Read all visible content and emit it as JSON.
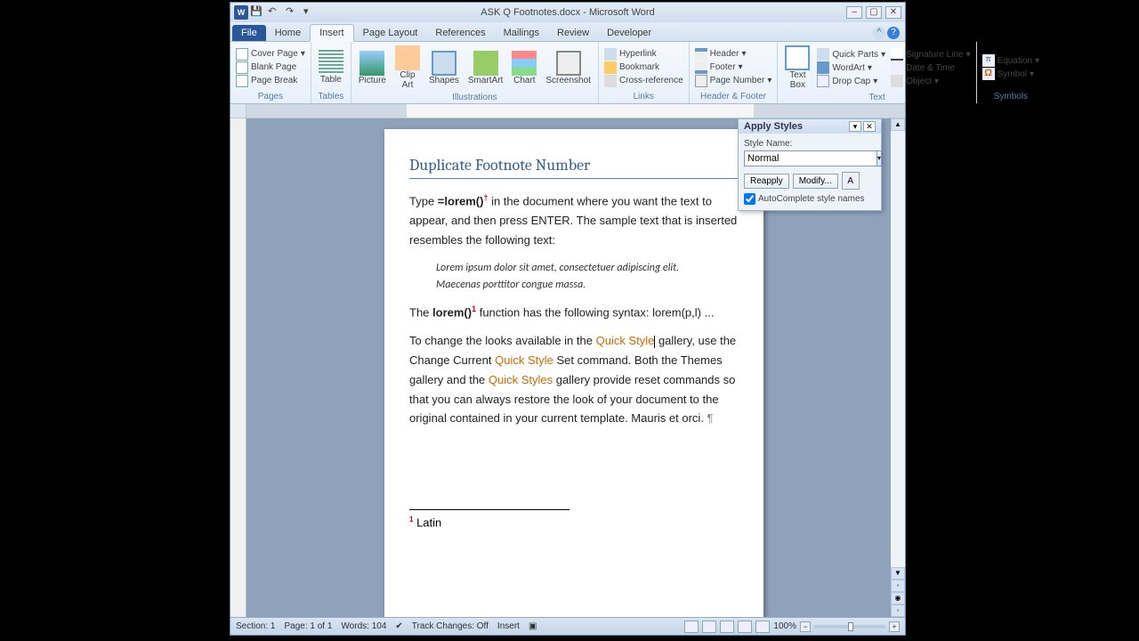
{
  "window": {
    "title": "ASK Q Footnotes.docx - Microsoft Word"
  },
  "tabs": {
    "file": "File",
    "home": "Home",
    "insert": "Insert",
    "pagelayout": "Page Layout",
    "references": "References",
    "mailings": "Mailings",
    "review": "Review",
    "developer": "Developer",
    "active": "insert"
  },
  "ribbon": {
    "pages": {
      "label": "Pages",
      "cover": "Cover Page",
      "blank": "Blank Page",
      "break": "Page Break"
    },
    "tables": {
      "label": "Tables",
      "table": "Table"
    },
    "illustrations": {
      "label": "Illustrations",
      "picture": "Picture",
      "clip": "Clip Art",
      "shapes": "Shapes",
      "smart": "SmartArt",
      "chart": "Chart",
      "screen": "Screenshot"
    },
    "links": {
      "label": "Links",
      "hyper": "Hyperlink",
      "book": "Bookmark",
      "cross": "Cross-reference"
    },
    "hf": {
      "label": "Header & Footer",
      "header": "Header",
      "footer": "Footer",
      "pgnum": "Page Number"
    },
    "text": {
      "label": "Text",
      "tbox": "Text Box",
      "qp": "Quick Parts",
      "wa": "WordArt",
      "cap": "Drop Cap",
      "sig": "Signature Line",
      "dt": "Date & Time",
      "obj": "Object"
    },
    "symbols": {
      "label": "Symbols",
      "eq": "Equation",
      "sym": "Symbol"
    }
  },
  "doc": {
    "heading": "Duplicate Footnote Number",
    "p1_a": "Type ",
    "p1_b": "=lorem()",
    "p1_c": " in the document where you want the text to appear, and then press ENTER. The sample text that is inserted resembles the following text:",
    "p2": "Lorem ipsum dolor sit amet, consectetuer adipiscing elit. Maecenas porttitor congue massa.",
    "p3_a": "The ",
    "p3_b": "lorem()",
    "p3_c": "  function has the following syntax: lorem(p,l) ...",
    "p4_a": "To change the looks available in the ",
    "p4_link1": "Quick Style",
    "p4_b": " gallery, use the Change Current ",
    "p4_link2": "Quick Style",
    "p4_c": " Set command. Both the Themes gallery and the ",
    "p4_link3": "Quick Styles",
    "p4_d": " gallery provide reset commands so that you can always restore the look of your document to the original contained in your current template. Mauris et orci.",
    "fn1": "Latin",
    "fnref": "1",
    "fnref2": "1",
    "dagger": "†"
  },
  "pane": {
    "title": "Apply Styles",
    "label": "Style Name:",
    "value": "Normal",
    "reapply": "Reapply",
    "modify": "Modify...",
    "auto": "AutoComplete style names"
  },
  "status": {
    "section": "Section: 1",
    "page": "Page: 1 of 1",
    "words": "Words: 104",
    "track": "Track Changes: Off",
    "insert": "Insert",
    "zoom": "100%"
  }
}
